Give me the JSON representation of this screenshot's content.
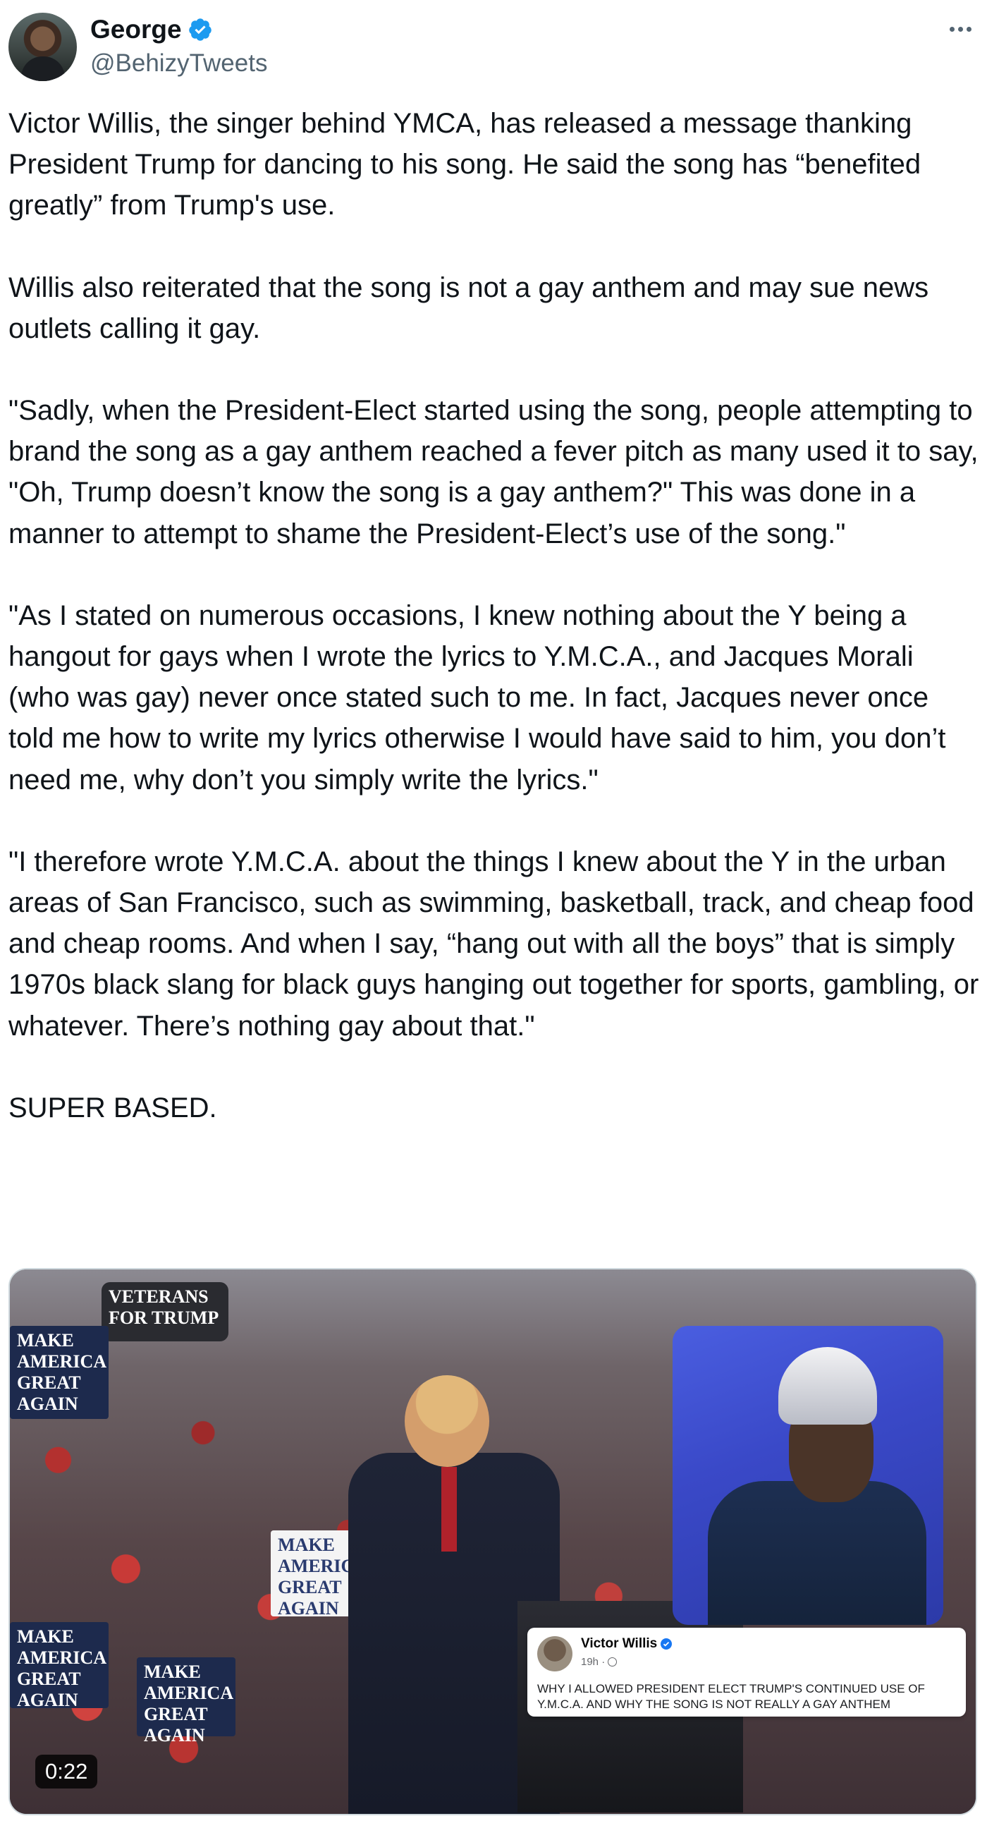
{
  "author": {
    "display_name": "George",
    "handle": "@BehizyTweets",
    "verified": true,
    "verified_color": "#1d9bf0",
    "avatar_icon": "profile-photo"
  },
  "menu": {
    "more_icon": "ellipsis-horizontal-icon"
  },
  "tweet": {
    "paragraphs": [
      "Victor Willis, the singer behind YMCA, has released a message thanking President Trump for dancing to his song. He said the song has “benefited greatly” from Trump's use.",
      "Willis also reiterated that the song is not a gay anthem and may sue news outlets calling it gay.",
      "\"Sadly, when the President-Elect started using the song, people attempting to brand the song as a gay anthem reached a fever pitch as many used it to say, \"Oh, Trump doesn’t know the song is a gay anthem?\" This was done in a manner to attempt to shame the President-Elect’s use of the song.\"",
      "\"As I stated on numerous occasions, I knew nothing about the Y being a hangout for gays when I wrote the lyrics to Y.M.C.A., and Jacques Morali (who was gay) never once stated such to me. In fact, Jacques never once told me how to write my lyrics otherwise I would have said to him, you don’t need me, why don’t you simply write the lyrics.\"",
      "\"I therefore wrote Y.M.C.A. about the things I knew about the Y in the urban areas of San Francisco, such as swimming, basketball, track, and cheap food and cheap rooms. And when I say, “hang out with all the boys” that is simply 1970s black slang for black guys hanging out together for sports, gambling, or whatever.  There’s nothing gay about that.\"",
      "SUPER BASED."
    ]
  },
  "media": {
    "type": "video",
    "duration": "0:22",
    "signs": [
      "VETERANS FOR TRUMP",
      "MAKE AMERICA GREAT AGAIN",
      "MAKE AMERICA GREAT AGAIN",
      "MAKE AMERICA GREAT AGAIN",
      "MAKE AMERICA GREAT AGAIN"
    ],
    "embedded_post": {
      "name": "Victor Willis",
      "time": "19h ·",
      "visibility_icon": "globe-icon",
      "text": "WHY I ALLOWED PRESIDENT ELECT TRUMP'S CONTINUED USE OF Y.M.C.A. AND WHY THE SONG IS NOT REALLY A GAY ANTHEM"
    }
  }
}
